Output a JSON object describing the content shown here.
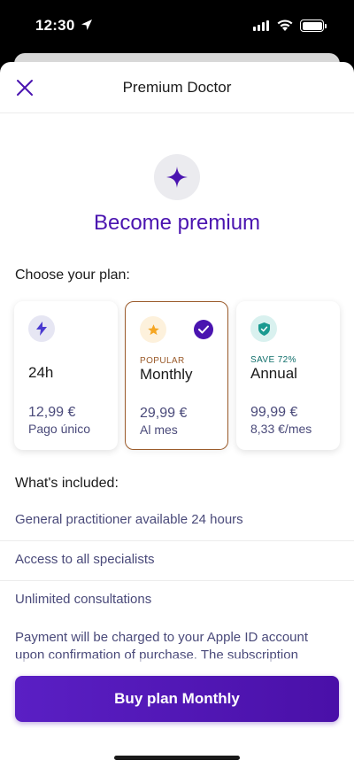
{
  "status_bar": {
    "time": "12:30"
  },
  "nav": {
    "title": "Premium Doctor"
  },
  "hero": {
    "title": "Become premium"
  },
  "plans_section": {
    "label": "Choose your plan:"
  },
  "plans": [
    {
      "badge": "",
      "name": "24h",
      "price": "12,99 €",
      "sub": "Pago único",
      "icon": "lightning-icon",
      "selected": false
    },
    {
      "badge": "POPULAR",
      "name": "Monthly",
      "price": "29,99 €",
      "sub": "Al mes",
      "icon": "star-icon",
      "selected": true
    },
    {
      "badge": "SAVE 72%",
      "name": "Annual",
      "price": "99,99 €",
      "sub": "8,33 €/mes",
      "icon": "shield-check-icon",
      "selected": false
    }
  ],
  "included": {
    "label": "What's included:",
    "items": [
      "General practitioner available 24 hours",
      "Access to all specialists",
      "Unlimited consultations"
    ]
  },
  "legal": {
    "text": "Payment will be charged to your Apple ID account upon confirmation of purchase. The subscription"
  },
  "cta": {
    "label": "Buy plan Monthly"
  },
  "colors": {
    "brand": "#4a14b0",
    "popular_badge": "#9a5a2a",
    "save_badge": "#0f6e6a"
  }
}
